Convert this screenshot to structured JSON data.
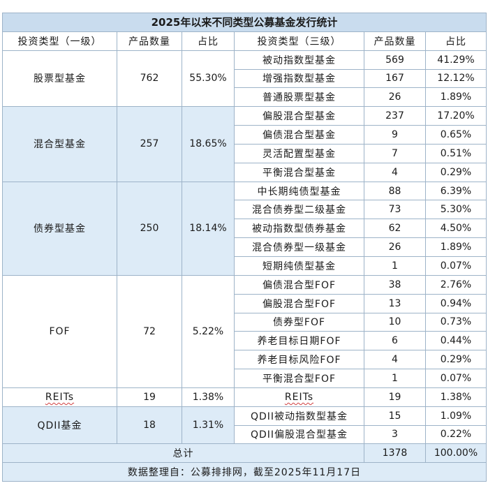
{
  "title": "2025年以来不同类型公募基金发行统计",
  "headers": [
    "投资类型（一级）",
    "产品数量",
    "占比",
    "投资类型（三级）",
    "产品数量",
    "占比"
  ],
  "groups": [
    {
      "name": "股票型基金",
      "count": "762",
      "share": "55.30%",
      "subs": [
        {
          "name": "被动指数型基金",
          "count": "569",
          "share": "41.29%"
        },
        {
          "name": "增强指数型基金",
          "count": "167",
          "share": "12.12%"
        },
        {
          "name": "普通股票型基金",
          "count": "26",
          "share": "1.89%"
        }
      ]
    },
    {
      "name": "混合型基金",
      "count": "257",
      "share": "18.65%",
      "subs": [
        {
          "name": "偏股混合型基金",
          "count": "237",
          "share": "17.20%"
        },
        {
          "name": "偏债混合型基金",
          "count": "9",
          "share": "0.65%"
        },
        {
          "name": "灵活配置型基金",
          "count": "7",
          "share": "0.51%"
        },
        {
          "name": "平衡混合型基金",
          "count": "4",
          "share": "0.29%"
        }
      ]
    },
    {
      "name": "债券型基金",
      "count": "250",
      "share": "18.14%",
      "subs": [
        {
          "name": "中长期纯债型基金",
          "count": "88",
          "share": "6.39%"
        },
        {
          "name": "混合债券型二级基金",
          "count": "73",
          "share": "5.30%"
        },
        {
          "name": "被动指数型债券基金",
          "count": "62",
          "share": "4.50%"
        },
        {
          "name": "混合债券型一级基金",
          "count": "26",
          "share": "1.89%"
        },
        {
          "name": "短期纯债型基金",
          "count": "1",
          "share": "0.07%"
        }
      ]
    },
    {
      "name": "FOF",
      "count": "72",
      "share": "5.22%",
      "subs": [
        {
          "name": "偏债混合型FOF",
          "count": "38",
          "share": "2.76%"
        },
        {
          "name": "偏股混合型FOF",
          "count": "13",
          "share": "0.94%"
        },
        {
          "name": "债券型FOF",
          "count": "10",
          "share": "0.73%"
        },
        {
          "name": "养老目标日期FOF",
          "count": "6",
          "share": "0.44%"
        },
        {
          "name": "养老目标风险FOF",
          "count": "4",
          "share": "0.29%"
        },
        {
          "name": "平衡混合型FOF",
          "count": "1",
          "share": "0.07%"
        }
      ]
    },
    {
      "name": "REITs",
      "count": "19",
      "share": "1.38%",
      "subs": [
        {
          "name": "REITs",
          "count": "19",
          "share": "1.38%"
        }
      ]
    },
    {
      "name": "QDII基金",
      "count": "18",
      "share": "1.31%",
      "subs": [
        {
          "name": "QDII被动指数型基金",
          "count": "15",
          "share": "1.09%"
        },
        {
          "name": "QDII偏股混合型基金",
          "count": "3",
          "share": "0.22%"
        }
      ]
    }
  ],
  "total": {
    "label": "总计",
    "count": "1378",
    "share": "100.00%"
  },
  "footer": "数据整理自：公募排排网，截至2025年11月17日"
}
